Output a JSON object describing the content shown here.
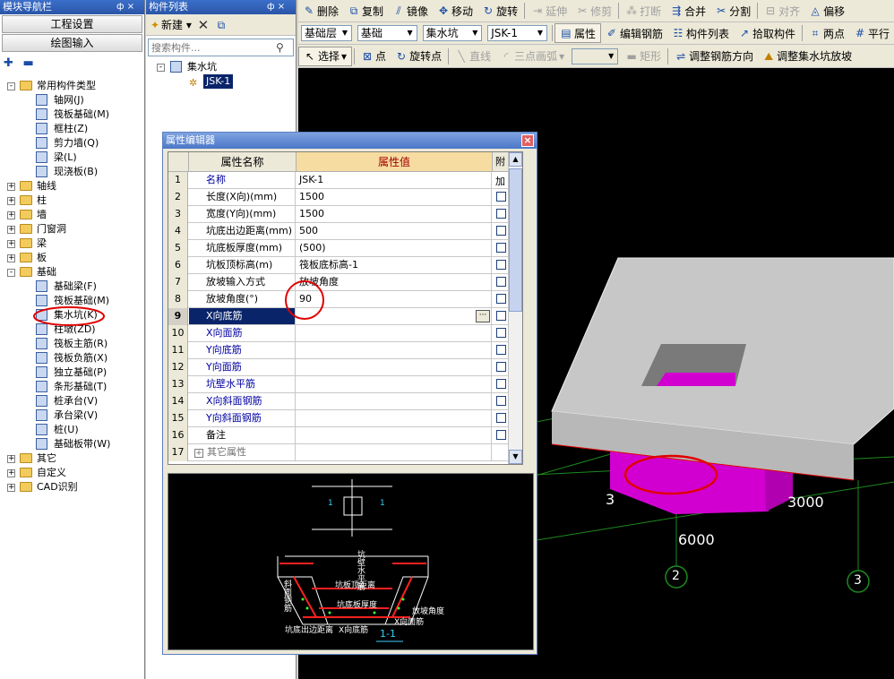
{
  "nav": {
    "title": "模块导航栏",
    "pin": "ф ×",
    "btn_project": "工程设置",
    "btn_drawing": "绘图输入",
    "tree": [
      {
        "label": "常用构件类型",
        "level": 0,
        "exp": "-",
        "kind": "folder"
      },
      {
        "label": "轴网(J)",
        "level": 1,
        "kind": "comp"
      },
      {
        "label": "筏板基础(M)",
        "level": 1,
        "kind": "comp"
      },
      {
        "label": "框柱(Z)",
        "level": 1,
        "kind": "comp"
      },
      {
        "label": "剪力墙(Q)",
        "level": 1,
        "kind": "comp"
      },
      {
        "label": "梁(L)",
        "level": 1,
        "kind": "comp"
      },
      {
        "label": "现浇板(B)",
        "level": 1,
        "kind": "comp"
      },
      {
        "label": "轴线",
        "level": 0,
        "exp": "+",
        "kind": "folder"
      },
      {
        "label": "柱",
        "level": 0,
        "exp": "+",
        "kind": "folder"
      },
      {
        "label": "墙",
        "level": 0,
        "exp": "+",
        "kind": "folder"
      },
      {
        "label": "门窗洞",
        "level": 0,
        "exp": "+",
        "kind": "folder"
      },
      {
        "label": "梁",
        "level": 0,
        "exp": "+",
        "kind": "folder"
      },
      {
        "label": "板",
        "level": 0,
        "exp": "+",
        "kind": "folder"
      },
      {
        "label": "基础",
        "level": 0,
        "exp": "-",
        "kind": "folder"
      },
      {
        "label": "基础梁(F)",
        "level": 1,
        "kind": "comp"
      },
      {
        "label": "筏板基础(M)",
        "level": 1,
        "kind": "comp"
      },
      {
        "label": "集水坑(K)",
        "level": 1,
        "kind": "comp"
      },
      {
        "label": "柱墩(ZD)",
        "level": 1,
        "kind": "comp"
      },
      {
        "label": "筏板主筋(R)",
        "level": 1,
        "kind": "comp"
      },
      {
        "label": "筏板负筋(X)",
        "level": 1,
        "kind": "comp"
      },
      {
        "label": "独立基础(P)",
        "level": 1,
        "kind": "comp"
      },
      {
        "label": "条形基础(T)",
        "level": 1,
        "kind": "comp"
      },
      {
        "label": "桩承台(V)",
        "level": 1,
        "kind": "comp"
      },
      {
        "label": "承台梁(V)",
        "level": 1,
        "kind": "comp"
      },
      {
        "label": "桩(U)",
        "level": 1,
        "kind": "comp"
      },
      {
        "label": "基础板带(W)",
        "level": 1,
        "kind": "comp"
      },
      {
        "label": "其它",
        "level": 0,
        "exp": "+",
        "kind": "folder"
      },
      {
        "label": "自定义",
        "level": 0,
        "exp": "+",
        "kind": "folder"
      },
      {
        "label": "CAD识别",
        "level": 0,
        "exp": "+",
        "kind": "folder"
      }
    ]
  },
  "clist": {
    "title": "构件列表",
    "pin": "ф ×",
    "new_label": "新建",
    "search_placeholder": "搜索构件...",
    "root_label": "集水坑",
    "child_label": "JSK-1"
  },
  "toolbar1": [
    {
      "label": "删除",
      "icon": "✎",
      "dis": false
    },
    {
      "label": "复制",
      "icon": "⧉",
      "dis": false
    },
    {
      "label": "镜像",
      "icon": "⫽",
      "dis": false
    },
    {
      "label": "移动",
      "icon": "✥",
      "dis": false
    },
    {
      "label": "旋转",
      "icon": "↻",
      "dis": false
    },
    {
      "label": "延伸",
      "icon": "⇥",
      "dis": true
    },
    {
      "label": "修剪",
      "icon": "✂",
      "dis": true
    },
    {
      "label": "打断",
      "icon": "⁂",
      "dis": true
    },
    {
      "label": "合并",
      "icon": "⇶",
      "dis": false
    },
    {
      "label": "分割",
      "icon": "✂",
      "dis": false
    },
    {
      "label": "对齐",
      "icon": "⊟",
      "dis": true
    },
    {
      "label": "偏移",
      "icon": "◬",
      "dis": false
    }
  ],
  "toolbar2": {
    "floor": "基础层",
    "category": "基础",
    "type": "集水坑",
    "component": "JSK-1",
    "btn_prop": "属性",
    "btn_rebar": "编辑钢筋",
    "btn_list": "构件列表",
    "btn_pick": "拾取构件",
    "btn_twopoint": "两点",
    "btn_parallel": "平行"
  },
  "toolbar3": {
    "select": "选择",
    "point": "点",
    "rotate_point": "旋转点",
    "line": "直线",
    "arc": "三点画弧",
    "rect": "矩形",
    "adjust_rebar": "调整钢筋方向",
    "adjust_slope": "调整集水坑放坡"
  },
  "prop": {
    "title": "属性编辑器",
    "col_name": "属性名称",
    "col_value": "属性值",
    "col_extra": "附加",
    "rows": [
      {
        "no": "1",
        "name": "名称",
        "value": "JSK-1",
        "blue": true,
        "cb": false
      },
      {
        "no": "2",
        "name": "长度(X向)(mm)",
        "value": "1500",
        "blue": false,
        "cb": true
      },
      {
        "no": "3",
        "name": "宽度(Y向)(mm)",
        "value": "1500",
        "blue": false,
        "cb": true
      },
      {
        "no": "4",
        "name": "坑底出边距离(mm)",
        "value": "500",
        "blue": false,
        "cb": true
      },
      {
        "no": "5",
        "name": "坑底板厚度(mm)",
        "value": "(500)",
        "blue": false,
        "cb": true
      },
      {
        "no": "6",
        "name": "坑板顶标高(m)",
        "value": "筏板底标高-1",
        "blue": false,
        "cb": true
      },
      {
        "no": "7",
        "name": "放坡输入方式",
        "value": "放坡角度",
        "blue": false,
        "cb": true
      },
      {
        "no": "8",
        "name": "放坡角度(°)",
        "value": "90",
        "blue": false,
        "cb": true
      },
      {
        "no": "9",
        "name": "X向底筋",
        "value": "",
        "blue": true,
        "cb": true,
        "sel": true
      },
      {
        "no": "10",
        "name": "X向面筋",
        "value": "",
        "blue": true,
        "cb": true
      },
      {
        "no": "11",
        "name": "Y向底筋",
        "value": "",
        "blue": true,
        "cb": true
      },
      {
        "no": "12",
        "name": "Y向面筋",
        "value": "",
        "blue": true,
        "cb": true
      },
      {
        "no": "13",
        "name": "坑壁水平筋",
        "value": "",
        "blue": true,
        "cb": true
      },
      {
        "no": "14",
        "name": "X向斜面钢筋",
        "value": "",
        "blue": true,
        "cb": true
      },
      {
        "no": "15",
        "name": "Y向斜面钢筋",
        "value": "",
        "blue": true,
        "cb": true
      },
      {
        "no": "16",
        "name": "备注",
        "value": "",
        "blue": false,
        "cb": true
      },
      {
        "no": "17",
        "name": "其它属性",
        "value": "",
        "blue": false,
        "cb": false,
        "group": true
      }
    ],
    "section_label": "1-1",
    "diagram_labels": {
      "wall_h": "坑壁水平筋",
      "top_dist": "坑板顶距离",
      "bottom_thk": "坑底板厚度",
      "slope_angle": "放坡角度",
      "x_face": "X向面筋",
      "x_bottom": "X向底筋",
      "edge_dist": "坑底出边距离",
      "slope_rebar": "斜面钢筋",
      "tag1": "1",
      "tag2": "1"
    }
  },
  "view": {
    "dim1": "3000",
    "dim2": "6000",
    "dim3": "3",
    "axis2": "2",
    "axis3": "3"
  },
  "colors": {
    "title_bar": "#2a55a8",
    "pit_magenta": "#d100d1",
    "slab_gray": "#c7c7c7",
    "grid_green": "#1d8a1d",
    "highlight_red": "#e00000"
  }
}
